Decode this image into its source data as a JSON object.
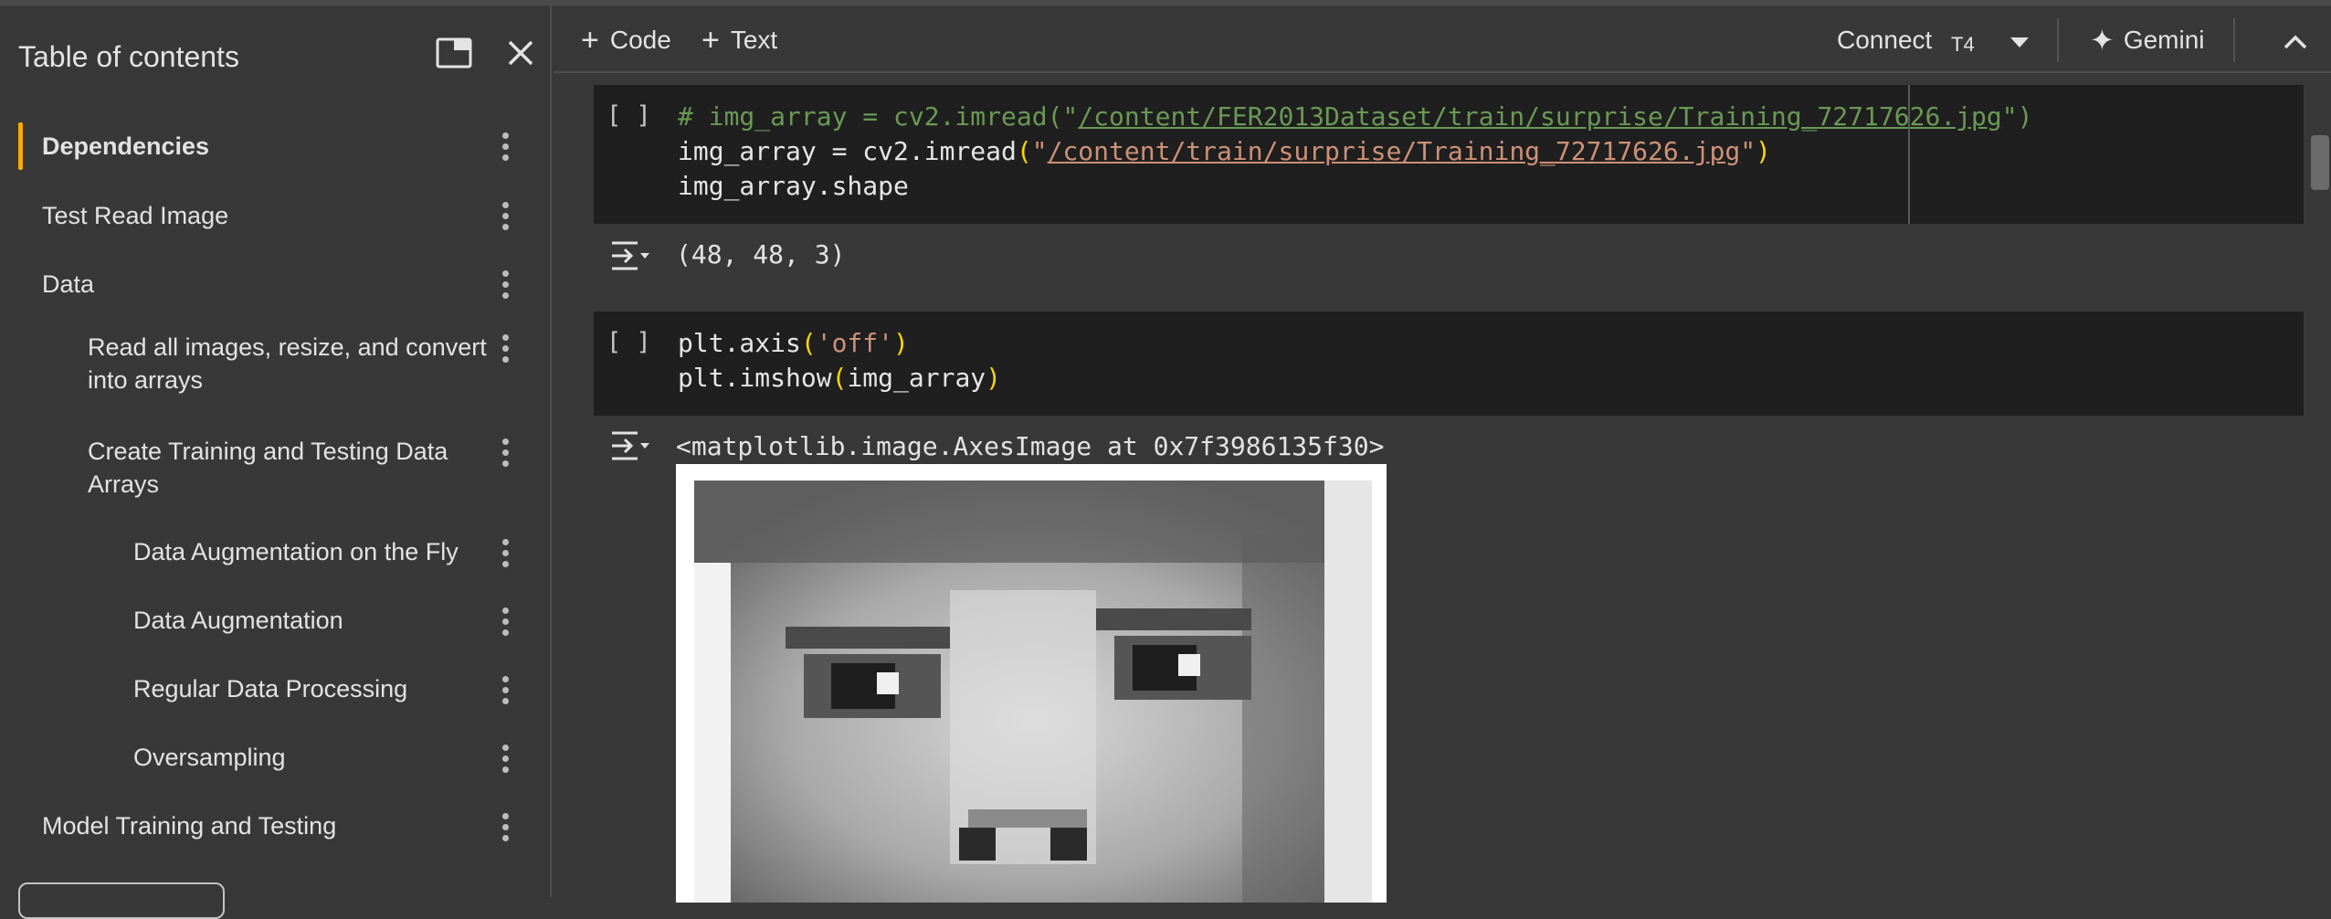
{
  "sidebar": {
    "title": "Table of contents",
    "items": [
      {
        "label": "Dependencies",
        "level": 1,
        "active": true
      },
      {
        "label": "Test Read Image",
        "level": 1
      },
      {
        "label": "Data",
        "level": 1
      },
      {
        "label_line1": "Read all images, resize, and convert",
        "label_line2": "into arrays",
        "level": 2
      },
      {
        "label_line1": "Create Training and Testing Data",
        "label_line2": "Arrays",
        "level": 2
      },
      {
        "label": "Data Augmentation on the Fly",
        "level": 3
      },
      {
        "label": "Data Augmentation",
        "level": 3
      },
      {
        "label": "Regular Data Processing",
        "level": 3
      },
      {
        "label": "Oversampling",
        "level": 3
      },
      {
        "label": "Model Training and Testing",
        "level": 1
      }
    ]
  },
  "toolbar": {
    "add_code": "Code",
    "add_text": "Text",
    "connect": "Connect",
    "runtime": "T4",
    "gemini": "Gemini"
  },
  "cells": [
    {
      "run_indicator": "[ ]",
      "line1_comment_prefix": "# img_array = cv2.imread(\"",
      "line1_comment_path": "/content/FER2013Dataset/train/surprise/Training_72717626.jpg",
      "line1_comment_suffix": "\")",
      "line2_prefix": "img_array = cv2.imread",
      "line2_paren_open": "(",
      "line2_q1": "\"",
      "line2_path": "/content/train/surprise/Training_72717626.jpg",
      "line2_q2": "\"",
      "line2_paren_close": ")",
      "line3": "img_array.shape",
      "output": "(48, 48, 3)"
    },
    {
      "run_indicator": "[ ]",
      "line1_prefix": "plt.axis",
      "line1_paren_open": "(",
      "line1_arg": "'off'",
      "line1_paren_close": ")",
      "line2_prefix": "plt.imshow",
      "line2_paren_open": "(",
      "line2_arg": "img_array",
      "line2_paren_close": ")",
      "output": "<matplotlib.image.AxesImage at 0x7f3986135f30>"
    }
  ],
  "colors": {
    "accent": "#f9ab00",
    "background": "#383838",
    "cell_background": "#1f1f1f"
  },
  "icons": [
    "popout-icon",
    "close-icon",
    "kebab-menu-icon",
    "plus-icon",
    "chevron-down-icon",
    "gemini-sparkle-icon",
    "chevron-up-icon",
    "output-toggle-icon"
  ]
}
